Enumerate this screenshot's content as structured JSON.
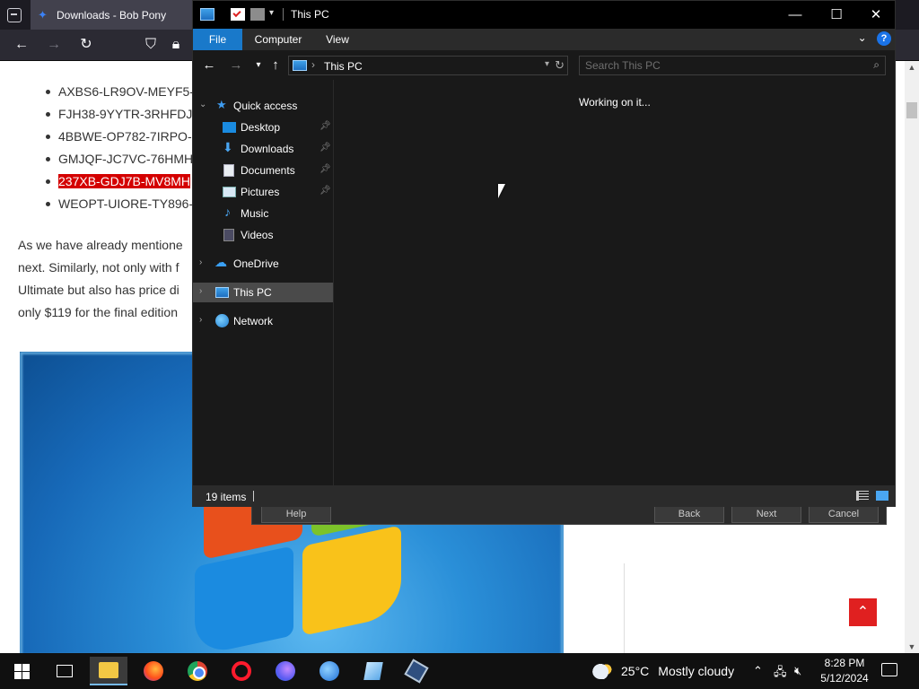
{
  "browser": {
    "tab_title": "Downloads - Bob Pony",
    "product_keys": [
      "AXBS6-LR9OV-MEYF5-",
      "FJH38-9YYTR-3RHFDJ-",
      "4BBWE-OP782-7IRPO-",
      "GMJQF-JC7VC-76HMH",
      "237XB-GDJ7B-MV8MH",
      "WEOPT-UIORE-TY896-"
    ],
    "highlighted_index": 4,
    "paragraph_lines": [
      "As we have already mentione",
      "next. Similarly, not only with f",
      "Ultimate but also has price di",
      "only $119 for the final edition"
    ]
  },
  "installer": {
    "help": "Help",
    "back": "Back",
    "next": "Next",
    "cancel": "Cancel"
  },
  "explorer": {
    "title": "This PC",
    "ribbon_tabs": [
      "File",
      "Computer",
      "View"
    ],
    "address": "This PC",
    "search_placeholder": "Search This PC",
    "status_text": "Working on it...",
    "item_count": "19 items",
    "nav": {
      "quick_access": "Quick access",
      "desktop": "Desktop",
      "downloads": "Downloads",
      "documents": "Documents",
      "pictures": "Pictures",
      "music": "Music",
      "videos": "Videos",
      "onedrive": "OneDrive",
      "this_pc": "This PC",
      "network": "Network"
    }
  },
  "taskbar": {
    "temperature": "25°C",
    "weather": "Mostly cloudy",
    "time": "8:28 PM",
    "date": "5/12/2024"
  }
}
